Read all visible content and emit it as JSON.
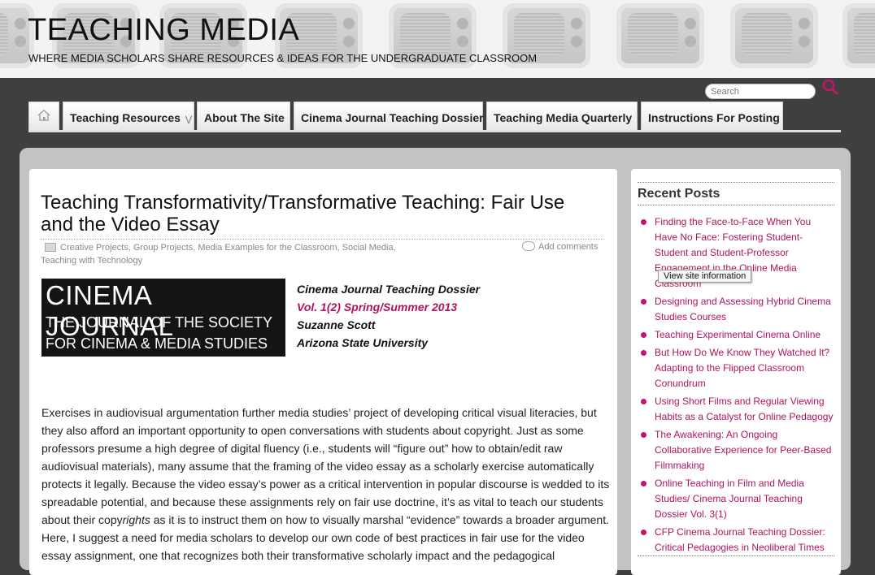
{
  "header": {
    "title": "TEACHING MEDIA",
    "tagline": "WHERE MEDIA SCHOLARS SHARE RESOURCES & IDEAS FOR THE UNDERGRADUATE CLASSROOM"
  },
  "search": {
    "placeholder": "Search",
    "icon": "search-icon"
  },
  "nav": {
    "home_icon": "home-icon",
    "items": [
      {
        "label": "Teaching Resources",
        "has_submenu": true
      },
      {
        "label": "About The Site"
      },
      {
        "label": "Cinema Journal Teaching Dossier"
      },
      {
        "label": "Teaching Media Quarterly"
      },
      {
        "label": "Instructions For Posting"
      }
    ]
  },
  "post": {
    "title": "Teaching Transformativity/Transformative Teaching: Fair Use and the Video Essay",
    "categories": "Creative Projects, Group Projects, Media Examples for the Classroom, Social Media, Teaching with Technology",
    "comments_link": "Add comments",
    "logo": {
      "line1": "CINEMA JOURNAL",
      "line2": "THE JOURNAL OF THE SOCIETY",
      "line3": "FOR CINEMA & MEDIA STUDIES"
    },
    "dossier": {
      "name": "Cinema Journal Teaching Dossier",
      "volume": "Vol. 1(2) Spring/Summer 2013",
      "author": "Suzanne Scott",
      "affiliation": "Arizona State University"
    },
    "body_before_em": "Exercises in audiovisual argumentation further media studies’ project of developing critical visual literacies, but they also afford an important opportunity to open conversations with students about copyright.  Just as some professors presume a high degree of digital fluency (i.e., students will “figure out” how to obtain/edit raw audiovisual materials), many assume that the framing of the video essay as a scholarly exercise automatically protects it legally.  Because the video essay’s power as a critical intervention in popular discourse is wedded to its spreadable potential, and because these assignments rely on fair use doctrine, it’s as vital to teach our students about their copy",
    "body_em": "rights",
    "body_after_em": " as it is to instruct them on how to visually marshal “evidence” towards a broader argument.  Here, I suggest a need for media scholars to develop our own code of best practices in fair use for the video essay assignment, one that recognizes both their transformative scholarly impact and the pedagogical"
  },
  "sidebar": {
    "heading": "Recent Posts",
    "posts": [
      "Finding the Face-to-Face When You Have No Face: Fostering Student-Student and Student-Professor Engagement in the Online Media Classroom",
      "Designing and Assessing Hybrid Cinema Studies Courses",
      "Teaching Experimental Cinema Online",
      "But How Do We Know They Watched It? Adapting to the Flipped Classroom Conundrum",
      "Using Short Films and Regular Viewing Habits as a Catalyst for Online Pedagogy",
      "The Awakening: An Ongoing Collaborative Experience for Peer-Based Filmmaking",
      "Online Teaching in Film and Media Studies/ Cinema Journal Teaching Dossier Vol. 3(1)",
      "CFP Cinema Journal Teaching Dossier: Critical Pedagogies in Neoliberal Times"
    ]
  },
  "tooltip": "View site information",
  "colors": {
    "accent": "#b0145c",
    "background": "#3f3f3f",
    "wrapper": "#c3c3c3"
  }
}
